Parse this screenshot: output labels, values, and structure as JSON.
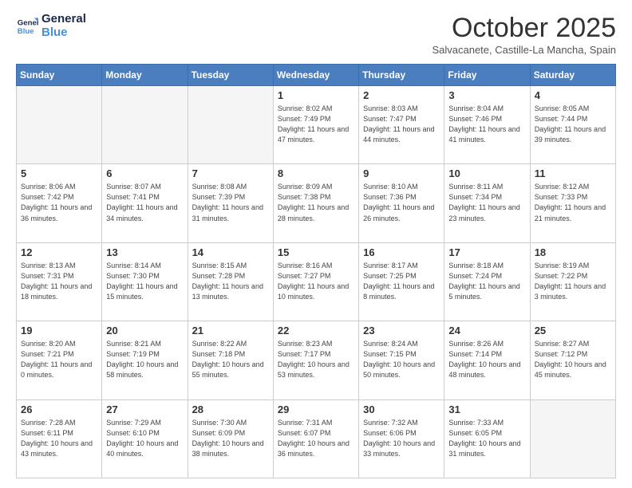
{
  "logo": {
    "line1": "General",
    "line2": "Blue"
  },
  "title": "October 2025",
  "location": "Salvacanete, Castille-La Mancha, Spain",
  "days_of_week": [
    "Sunday",
    "Monday",
    "Tuesday",
    "Wednesday",
    "Thursday",
    "Friday",
    "Saturday"
  ],
  "weeks": [
    [
      {
        "day": "",
        "info": ""
      },
      {
        "day": "",
        "info": ""
      },
      {
        "day": "",
        "info": ""
      },
      {
        "day": "1",
        "info": "Sunrise: 8:02 AM\nSunset: 7:49 PM\nDaylight: 11 hours\nand 47 minutes."
      },
      {
        "day": "2",
        "info": "Sunrise: 8:03 AM\nSunset: 7:47 PM\nDaylight: 11 hours\nand 44 minutes."
      },
      {
        "day": "3",
        "info": "Sunrise: 8:04 AM\nSunset: 7:46 PM\nDaylight: 11 hours\nand 41 minutes."
      },
      {
        "day": "4",
        "info": "Sunrise: 8:05 AM\nSunset: 7:44 PM\nDaylight: 11 hours\nand 39 minutes."
      }
    ],
    [
      {
        "day": "5",
        "info": "Sunrise: 8:06 AM\nSunset: 7:42 PM\nDaylight: 11 hours\nand 36 minutes."
      },
      {
        "day": "6",
        "info": "Sunrise: 8:07 AM\nSunset: 7:41 PM\nDaylight: 11 hours\nand 34 minutes."
      },
      {
        "day": "7",
        "info": "Sunrise: 8:08 AM\nSunset: 7:39 PM\nDaylight: 11 hours\nand 31 minutes."
      },
      {
        "day": "8",
        "info": "Sunrise: 8:09 AM\nSunset: 7:38 PM\nDaylight: 11 hours\nand 28 minutes."
      },
      {
        "day": "9",
        "info": "Sunrise: 8:10 AM\nSunset: 7:36 PM\nDaylight: 11 hours\nand 26 minutes."
      },
      {
        "day": "10",
        "info": "Sunrise: 8:11 AM\nSunset: 7:34 PM\nDaylight: 11 hours\nand 23 minutes."
      },
      {
        "day": "11",
        "info": "Sunrise: 8:12 AM\nSunset: 7:33 PM\nDaylight: 11 hours\nand 21 minutes."
      }
    ],
    [
      {
        "day": "12",
        "info": "Sunrise: 8:13 AM\nSunset: 7:31 PM\nDaylight: 11 hours\nand 18 minutes."
      },
      {
        "day": "13",
        "info": "Sunrise: 8:14 AM\nSunset: 7:30 PM\nDaylight: 11 hours\nand 15 minutes."
      },
      {
        "day": "14",
        "info": "Sunrise: 8:15 AM\nSunset: 7:28 PM\nDaylight: 11 hours\nand 13 minutes."
      },
      {
        "day": "15",
        "info": "Sunrise: 8:16 AM\nSunset: 7:27 PM\nDaylight: 11 hours\nand 10 minutes."
      },
      {
        "day": "16",
        "info": "Sunrise: 8:17 AM\nSunset: 7:25 PM\nDaylight: 11 hours\nand 8 minutes."
      },
      {
        "day": "17",
        "info": "Sunrise: 8:18 AM\nSunset: 7:24 PM\nDaylight: 11 hours\nand 5 minutes."
      },
      {
        "day": "18",
        "info": "Sunrise: 8:19 AM\nSunset: 7:22 PM\nDaylight: 11 hours\nand 3 minutes."
      }
    ],
    [
      {
        "day": "19",
        "info": "Sunrise: 8:20 AM\nSunset: 7:21 PM\nDaylight: 11 hours\nand 0 minutes."
      },
      {
        "day": "20",
        "info": "Sunrise: 8:21 AM\nSunset: 7:19 PM\nDaylight: 10 hours\nand 58 minutes."
      },
      {
        "day": "21",
        "info": "Sunrise: 8:22 AM\nSunset: 7:18 PM\nDaylight: 10 hours\nand 55 minutes."
      },
      {
        "day": "22",
        "info": "Sunrise: 8:23 AM\nSunset: 7:17 PM\nDaylight: 10 hours\nand 53 minutes."
      },
      {
        "day": "23",
        "info": "Sunrise: 8:24 AM\nSunset: 7:15 PM\nDaylight: 10 hours\nand 50 minutes."
      },
      {
        "day": "24",
        "info": "Sunrise: 8:26 AM\nSunset: 7:14 PM\nDaylight: 10 hours\nand 48 minutes."
      },
      {
        "day": "25",
        "info": "Sunrise: 8:27 AM\nSunset: 7:12 PM\nDaylight: 10 hours\nand 45 minutes."
      }
    ],
    [
      {
        "day": "26",
        "info": "Sunrise: 7:28 AM\nSunset: 6:11 PM\nDaylight: 10 hours\nand 43 minutes."
      },
      {
        "day": "27",
        "info": "Sunrise: 7:29 AM\nSunset: 6:10 PM\nDaylight: 10 hours\nand 40 minutes."
      },
      {
        "day": "28",
        "info": "Sunrise: 7:30 AM\nSunset: 6:09 PM\nDaylight: 10 hours\nand 38 minutes."
      },
      {
        "day": "29",
        "info": "Sunrise: 7:31 AM\nSunset: 6:07 PM\nDaylight: 10 hours\nand 36 minutes."
      },
      {
        "day": "30",
        "info": "Sunrise: 7:32 AM\nSunset: 6:06 PM\nDaylight: 10 hours\nand 33 minutes."
      },
      {
        "day": "31",
        "info": "Sunrise: 7:33 AM\nSunset: 6:05 PM\nDaylight: 10 hours\nand 31 minutes."
      },
      {
        "day": "",
        "info": ""
      }
    ]
  ]
}
